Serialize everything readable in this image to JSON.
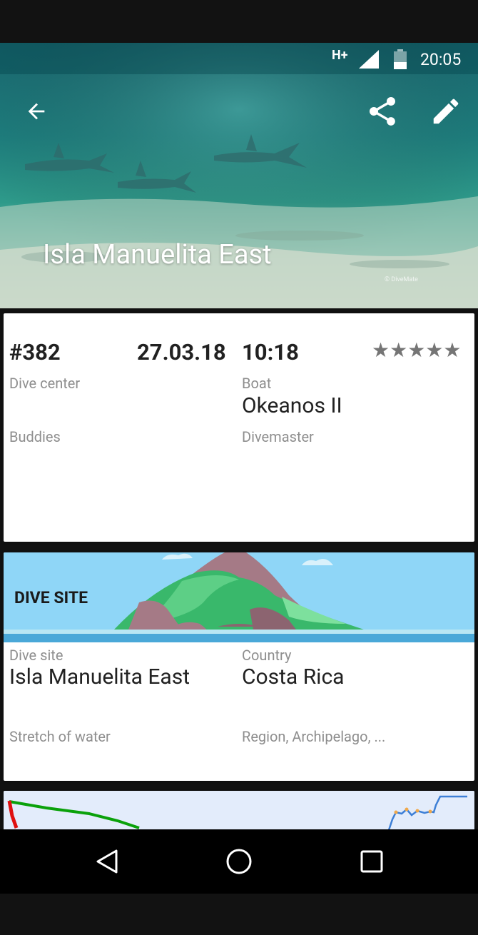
{
  "status_bar": {
    "network": "H+",
    "time": "20:05",
    "signal_icon": "signal-icon",
    "battery_icon": "battery-icon"
  },
  "app_bar": {
    "back_icon": "arrow-back-icon",
    "share_icon": "share-icon",
    "edit_icon": "edit-pencil-icon"
  },
  "hero": {
    "title": "Isla Manuelita East",
    "watermark": "© DiveMate"
  },
  "dive_card": {
    "number": "#382",
    "date": "27.03.18",
    "time": "10:18",
    "rating": "★★★★★",
    "rating_value": 5,
    "dive_center_label": "Dive center",
    "dive_center_value": "",
    "boat_label": "Boat",
    "boat_value": "Okeanos II",
    "buddies_label": "Buddies",
    "divemaster_label": "Divemaster"
  },
  "dive_site_card": {
    "header": "DIVE SITE",
    "dive_site_label": "Dive site",
    "dive_site_value": "Isla Manuelita East",
    "country_label": "Country",
    "country_value": "Costa Rica",
    "stretch_label": "Stretch of water",
    "region_label": "Region, Archipelago, ..."
  },
  "nav_bar": {
    "back_icon": "nav-back-triangle-icon",
    "home_icon": "nav-home-circle-icon",
    "recents_icon": "nav-recents-square-icon"
  },
  "colors": {
    "site_header_bg": "#8fd6f7",
    "profile_bg": "#e3ecfb",
    "temp_line": "#0aa10a",
    "depth_red": "#e01010",
    "depth_blue": "#3d7fd6"
  }
}
